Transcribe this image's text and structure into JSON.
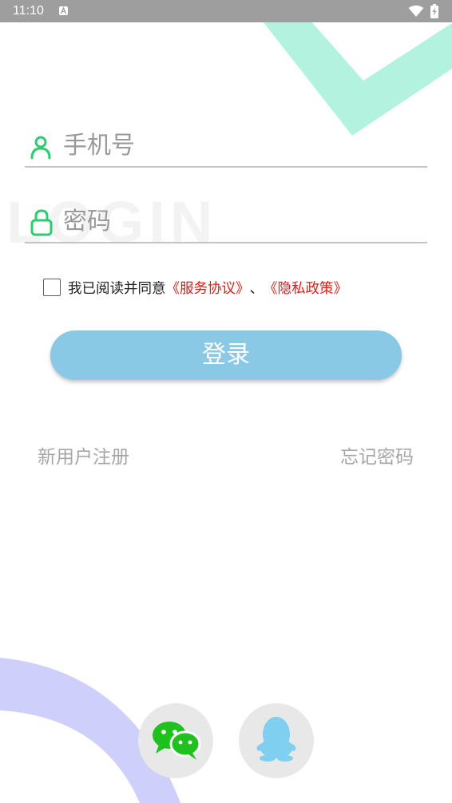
{
  "status_bar": {
    "time": "11:10",
    "icons": [
      "a-notification-icon",
      "wifi-icon",
      "battery-charging-icon"
    ]
  },
  "watermark": "LOGIN",
  "login_form": {
    "phone": {
      "placeholder": "手机号",
      "value": "",
      "icon": "user-icon"
    },
    "password": {
      "placeholder": "密码",
      "value": "",
      "icon": "lock-icon"
    },
    "agreement": {
      "checked": false,
      "prefix": "我已阅读并同意",
      "service_link": "《服务协议》",
      "separator": "、",
      "privacy_link": "《隐私政策》"
    },
    "login_button": "登录"
  },
  "links": {
    "register": "新用户注册",
    "forgot_password": "忘记密码"
  },
  "social_login": [
    {
      "name": "wechat",
      "icon": "wechat-icon"
    },
    {
      "name": "qq",
      "icon": "qq-icon"
    }
  ],
  "colors": {
    "status_bar": "#9e9e9e",
    "icon_green": "#2ecc71",
    "button": "#89c9e5",
    "link_red": "#d91e18",
    "deco_mint": "#b3f2df",
    "deco_lavender": "#cfcffb",
    "wechat_green": "#1fc11f",
    "qq_blue": "#7fcff0"
  }
}
